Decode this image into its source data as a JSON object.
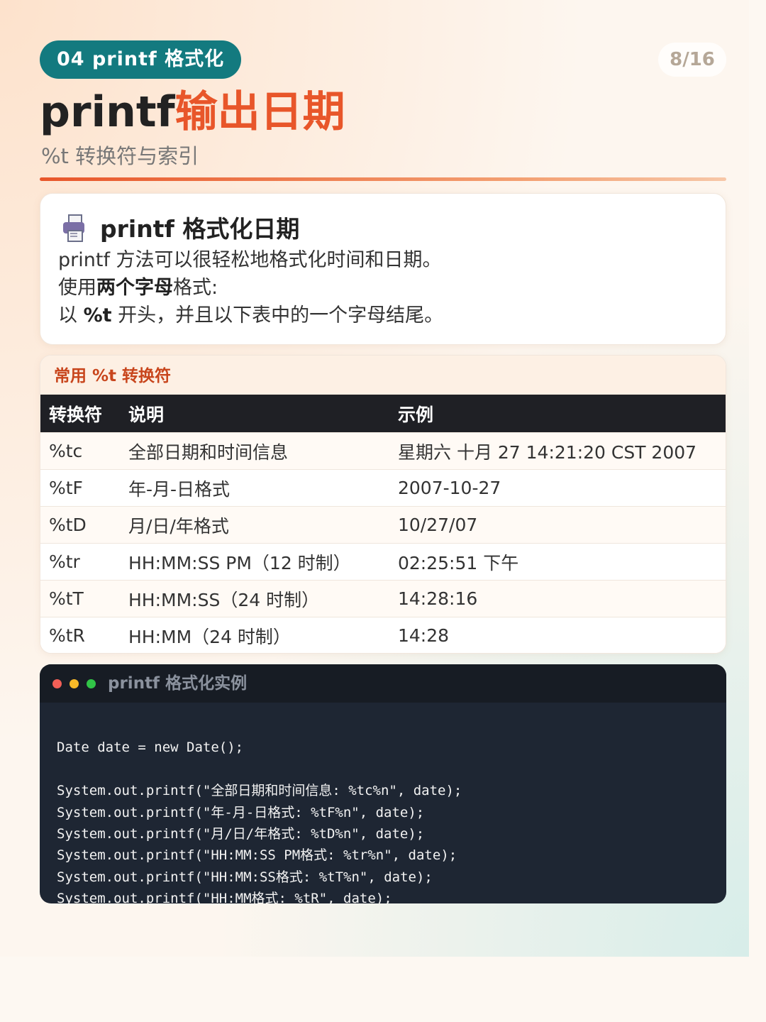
{
  "header": {
    "badge": "04 printf 格式化",
    "page_indicator": "8/16",
    "title_plain": "printf",
    "title_accent": "输出日期",
    "subtitle": "%t 转换符与索引"
  },
  "intro_card": {
    "icon": "printer-icon",
    "title": "printf 格式化日期",
    "line1": "printf 方法可以很轻松地格式化时间和日期。",
    "line2_prefix": "使用",
    "line2_bold": "两个字母",
    "line2_suffix": "格式:",
    "line3_prefix": "以 ",
    "line3_bold": "%t",
    "line3_suffix": " 开头，并且以下表中的一个字母结尾。"
  },
  "table": {
    "caption": "常用 %t 转换符",
    "headers": [
      "转换符",
      "说明",
      "示例"
    ],
    "rows": [
      [
        "%tc",
        "全部日期和时间信息",
        "星期六 十月 27 14:21:20 CST 2007"
      ],
      [
        "%tF",
        "年-月-日格式",
        "2007-10-27"
      ],
      [
        "%tD",
        "月/日/年格式",
        "10/27/07"
      ],
      [
        "%tr",
        "HH:MM:SS PM（12 时制）",
        "02:25:51 下午"
      ],
      [
        "%tT",
        "HH:MM:SS（24 时制）",
        "14:28:16"
      ],
      [
        "%tR",
        "HH:MM（24 时制）",
        "14:28"
      ]
    ]
  },
  "code": {
    "title": "printf 格式化实例",
    "window_dots": [
      "#f25f57",
      "#f7b928",
      "#31c447"
    ],
    "lines": [
      "Date date = new Date();",
      "",
      "System.out.printf(\"全部日期和时间信息: %tc%n\", date);",
      "System.out.printf(\"年-月-日格式: %tF%n\", date);",
      "System.out.printf(\"月/日/年格式: %tD%n\", date);",
      "System.out.printf(\"HH:MM:SS PM格式: %tr%n\", date);",
      "System.out.printf(\"HH:MM:SS格式: %tT%n\", date);",
      "System.out.printf(\"HH:MM格式: %tR\", date);"
    ]
  },
  "colors": {
    "accent": "#e8562a",
    "badge": "#137a7f",
    "table_header": "#1f2025",
    "code_bg": "#1e2633"
  }
}
